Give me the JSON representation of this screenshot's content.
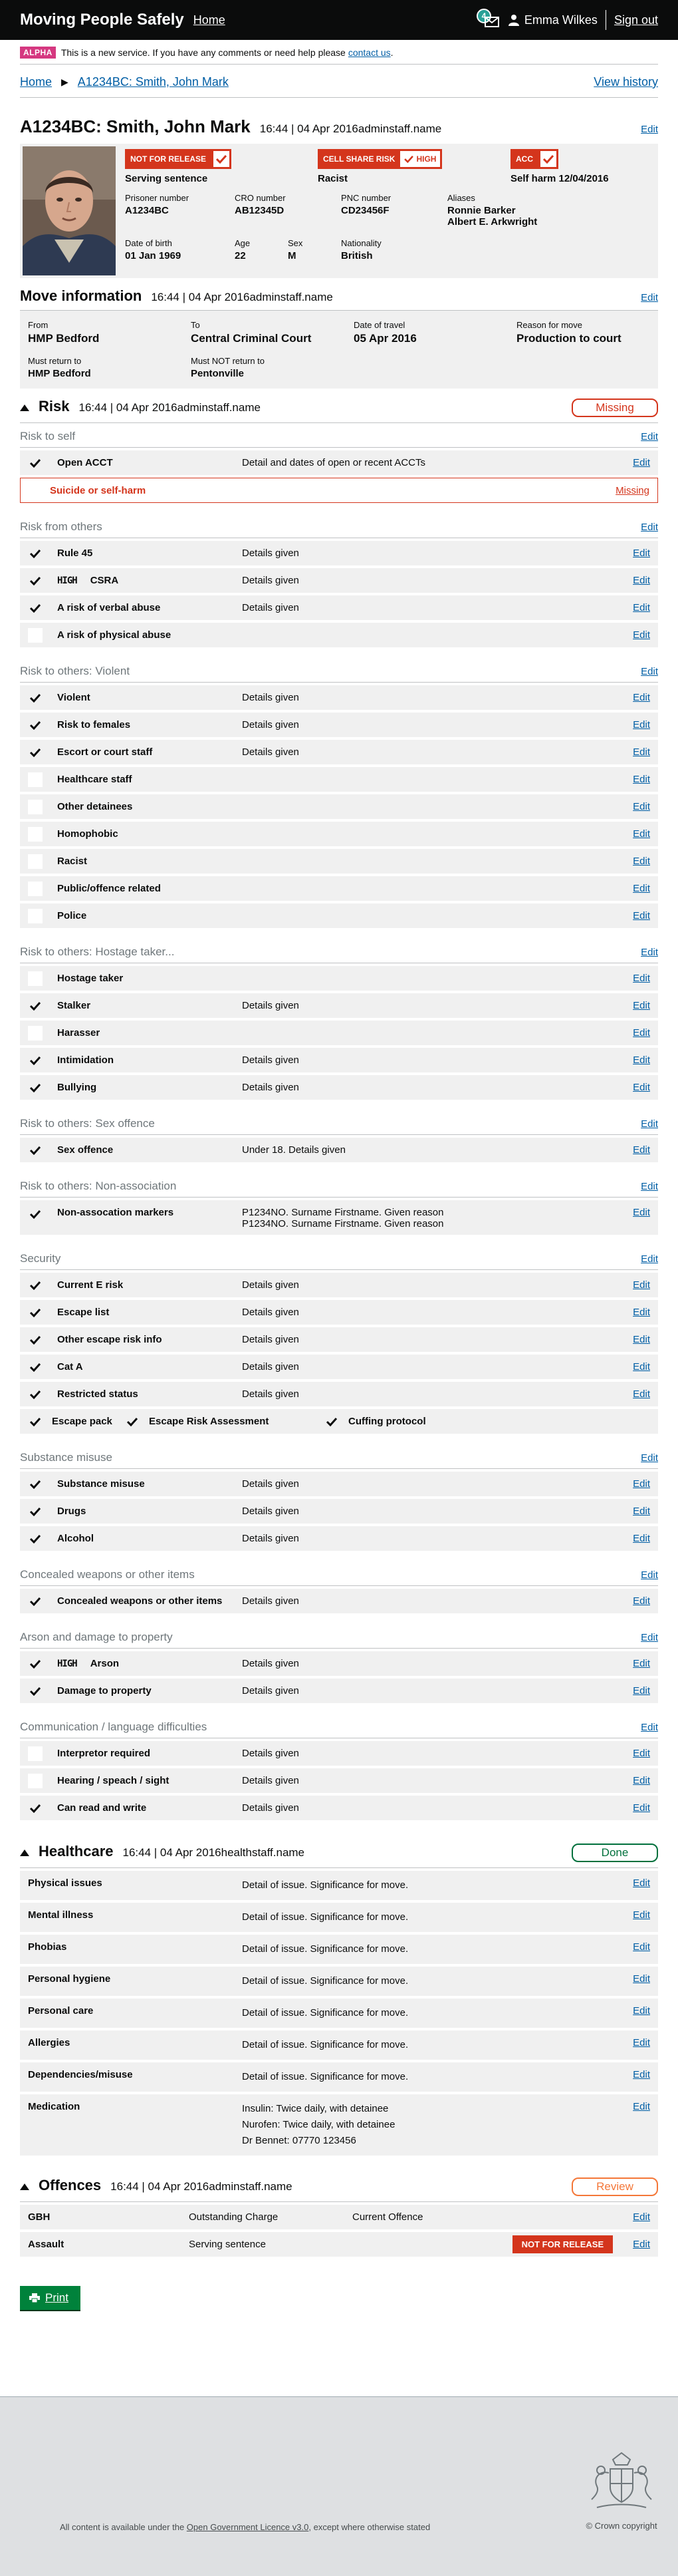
{
  "header": {
    "service_name": "Moving People Safely",
    "home_link": "Home",
    "notification_count": "4",
    "user_name": "Emma Wilkes",
    "sign_out": "Sign out"
  },
  "phase_banner": {
    "tag": "ALPHA",
    "text": "This is a new service. If you have any comments or need help please ",
    "link": "contact us",
    "suffix": "."
  },
  "breadcrumbs": {
    "home": "Home",
    "current": "A1234BC: Smith, John Mark",
    "view_history": "View history"
  },
  "profile": {
    "title": "A1234BC: Smith, John Mark",
    "timestamp": "16:44 | 04 Apr 2016",
    "user": "adminstaff.name",
    "edit": "Edit",
    "alerts": [
      {
        "label": "NOT FOR RELEASE",
        "sub": "Serving sentence"
      },
      {
        "label": "CELL SHARE RISK",
        "level": "HIGH",
        "sub": "Racist"
      },
      {
        "label": "ACC",
        "sub": "Self harm 12/04/2016"
      }
    ],
    "prisoner_number_label": "Prisoner number",
    "prisoner_number": "A1234BC",
    "cro_label": "CRO number",
    "cro": "AB12345D",
    "pnc_label": "PNC number",
    "pnc": "CD23456F",
    "aliases_label": "Aliases",
    "alias_1": "Ronnie Barker",
    "alias_2": "Albert E. Arkwright",
    "dob_label": "Date of birth",
    "dob": "01 Jan 1969",
    "age_label": "Age",
    "age": "22",
    "sex_label": "Sex",
    "sex": "M",
    "nationality_label": "Nationality",
    "nationality": "British"
  },
  "move": {
    "title": "Move information",
    "timestamp": "16:44 | 04 Apr 2016",
    "user": "adminstaff.name",
    "edit": "Edit",
    "from_label": "From",
    "from": "HMP Bedford",
    "to_label": "To",
    "to": "Central Criminal Court",
    "date_label": "Date of travel",
    "date": "05 Apr 2016",
    "reason_label": "Reason for move",
    "reason": "Production to court",
    "must_return_label": "Must return to",
    "must_return": "HMP Bedford",
    "must_not_return_label": "Must NOT return to",
    "must_not_return": "Pentonville"
  },
  "risk": {
    "title": "Risk",
    "timestamp": "16:44 | 04 Apr 2016",
    "user": "adminstaff.name",
    "status": "Missing",
    "edit": "Edit",
    "high": "HIGH",
    "missing_label": "Missing",
    "sections": {
      "self": {
        "title": "Risk to self",
        "items": [
          {
            "name": "Open ACCT",
            "detail": "Detail and dates of open or recent ACCTs",
            "checked": true
          }
        ],
        "missing": {
          "name": "Suicide or self-harm"
        }
      },
      "others": {
        "title": "Risk from others",
        "items": [
          {
            "name": "Rule 45",
            "detail": "Details given",
            "checked": true
          },
          {
            "name": "CSRA",
            "detail": "Details given",
            "checked": true,
            "high": true
          },
          {
            "name": "A risk of verbal abuse",
            "detail": "Details given",
            "checked": true
          },
          {
            "name": "A risk of physical abuse",
            "detail": "",
            "checked": false
          }
        ]
      },
      "violent": {
        "title": "Risk to others: Violent",
        "items": [
          {
            "name": "Violent",
            "detail": "Details given",
            "checked": true
          },
          {
            "name": "Risk to females",
            "detail": "Details given",
            "checked": true
          },
          {
            "name": "Escort or court staff",
            "detail": "Details given",
            "checked": true
          },
          {
            "name": "Healthcare staff",
            "detail": "",
            "checked": false
          },
          {
            "name": "Other detainees",
            "detail": "",
            "checked": false
          },
          {
            "name": "Homophobic",
            "detail": "",
            "checked": false
          },
          {
            "name": "Racist",
            "detail": "",
            "checked": false
          },
          {
            "name": "Public/offence related",
            "detail": "",
            "checked": false
          },
          {
            "name": "Police",
            "detail": "",
            "checked": false
          }
        ]
      },
      "hostage": {
        "title": "Risk to others: Hostage taker...",
        "items": [
          {
            "name": "Hostage taker",
            "detail": "",
            "checked": false
          },
          {
            "name": "Stalker",
            "detail": "Details given",
            "checked": true
          },
          {
            "name": "Harasser",
            "detail": "",
            "checked": false
          },
          {
            "name": "Intimidation",
            "detail": "Details given",
            "checked": true
          },
          {
            "name": "Bullying",
            "detail": "Details given",
            "checked": true
          }
        ]
      },
      "sex": {
        "title": "Risk to others: Sex offence",
        "items": [
          {
            "name": "Sex offence",
            "detail": "Under 18. Details given",
            "checked": true
          }
        ]
      },
      "nonassoc": {
        "title": "Risk to others: Non-association",
        "items": [
          {
            "name": "Non-assocation markers",
            "detail_1": "P1234NO. Surname Firstname. Given reason",
            "detail_2": "P1234NO. Surname Firstname. Given reason",
            "checked": true
          }
        ]
      },
      "security": {
        "title": "Security",
        "items": [
          {
            "name": "Current E risk",
            "detail": "Details given",
            "checked": true
          },
          {
            "name": "Escape list",
            "detail": "Details given",
            "checked": true
          },
          {
            "name": "Other escape risk info",
            "detail": "Details given",
            "checked": true
          },
          {
            "name": "Cat A",
            "detail": "Details given",
            "checked": true
          },
          {
            "name": "Restricted status",
            "detail": "Details given",
            "checked": true
          }
        ],
        "triple": [
          "Escape pack",
          "Escape Risk Assessment",
          "Cuffing protocol"
        ]
      },
      "substance": {
        "title": "Substance misuse",
        "items": [
          {
            "name": "Substance misuse",
            "detail": "Details given",
            "checked": true
          },
          {
            "name": "Drugs",
            "detail": "Details given",
            "checked": true
          },
          {
            "name": "Alcohol",
            "detail": "Details given",
            "checked": true
          }
        ]
      },
      "concealed": {
        "title": "Concealed weapons or other items",
        "items": [
          {
            "name": "Concealed weapons or other items",
            "detail": "Details given",
            "checked": true
          }
        ]
      },
      "arson": {
        "title": "Arson and damage to property",
        "items": [
          {
            "name": "Arson",
            "detail": "Details given",
            "checked": true,
            "high": true
          },
          {
            "name": "Damage to property",
            "detail": "Details given",
            "checked": true
          }
        ]
      },
      "comms": {
        "title": "Communication / language difficulties",
        "items": [
          {
            "name": "Interpretor required",
            "detail": "Details given",
            "checked": false
          },
          {
            "name": "Hearing / speach / sight",
            "detail": "Details given",
            "checked": false
          },
          {
            "name": "Can read and write",
            "detail": "Details given",
            "checked": true
          }
        ]
      }
    }
  },
  "healthcare": {
    "title": "Healthcare",
    "timestamp": "16:44 | 04 Apr 2016",
    "user": "healthstaff.name",
    "status": "Done",
    "edit": "Edit",
    "items": [
      {
        "name": "Physical issues",
        "detail": "Detail of issue. Significance for move."
      },
      {
        "name": "Mental illness",
        "detail": "Detail of issue. Significance for move."
      },
      {
        "name": "Phobias",
        "detail": "Detail of issue. Significance for move."
      },
      {
        "name": "Personal hygiene",
        "detail": "Detail of issue. Significance for move."
      },
      {
        "name": "Personal care",
        "detail": "Detail of issue. Significance for move."
      },
      {
        "name": "Allergies",
        "detail": "Detail of issue. Significance for move."
      },
      {
        "name": "Dependencies/misuse",
        "detail": "Detail of issue. Significance for move."
      }
    ],
    "medication": {
      "name": "Medication",
      "line_1": "Insulin: Twice daily, with detainee",
      "line_2": "Nurofen: Twice daily, with detainee",
      "line_3": "Dr Bennet: 07770 123456"
    }
  },
  "offences": {
    "title": "Offences",
    "timestamp": "16:44 | 04 Apr 2016",
    "user": "adminstaff.name",
    "status": "Review",
    "edit": "Edit",
    "rows": [
      {
        "name": "GBH",
        "d1": "Outstanding Charge",
        "d2": "Current Offence"
      },
      {
        "name": "Assault",
        "d1": "Serving sentence",
        "badge": "NOT FOR RELEASE"
      }
    ]
  },
  "print_button": "Print",
  "footer": {
    "licence_prefix": "All content is available under the ",
    "licence_link": "Open Government Licence v3.0",
    "licence_suffix": ", except where otherwise stated",
    "copyright": "© Crown copyright"
  },
  "colors": {
    "header": "#0b0c0c",
    "link": "#005ea5",
    "alert_red": "#d4351c",
    "done_green": "#00703c",
    "review_orange": "#f47738",
    "alpha_pink": "#d53880",
    "panel_grey": "#f0f0f0"
  }
}
